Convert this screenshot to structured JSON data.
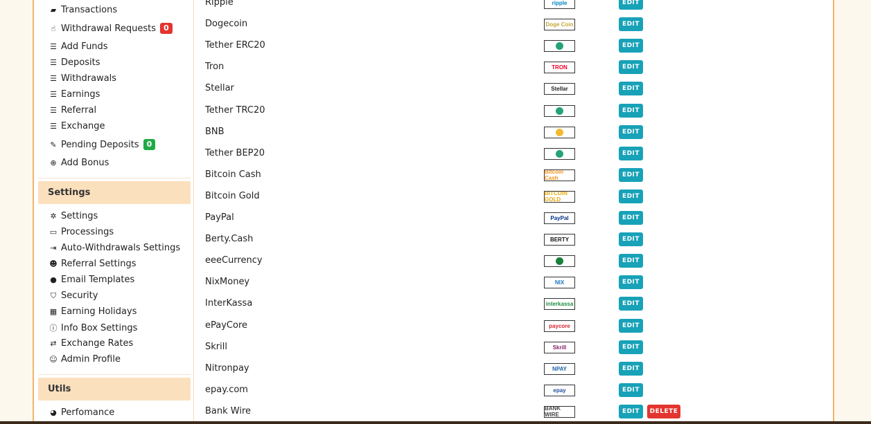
{
  "sidebar": {
    "items_top": [
      {
        "label": "Transactions",
        "icon": "book-icon",
        "badge": null
      },
      {
        "label": "Withdrawal Requests",
        "icon": "hand-icon",
        "badge": "0",
        "badge_color": "#e3342f"
      },
      {
        "label": "Add Funds",
        "icon": "list-icon",
        "badge": null
      },
      {
        "label": "Deposits",
        "icon": "list-icon",
        "badge": null
      },
      {
        "label": "Withdrawals",
        "icon": "list-icon",
        "badge": null
      },
      {
        "label": "Earnings",
        "icon": "list-icon",
        "badge": null
      },
      {
        "label": "Referral",
        "icon": "list-icon",
        "badge": null
      },
      {
        "label": "Exchange",
        "icon": "list-icon",
        "badge": null
      },
      {
        "label": "Pending Deposits",
        "icon": "pin-icon",
        "badge": "0",
        "badge_color": "#20a946"
      },
      {
        "label": "Add Bonus",
        "icon": "plus-circle-icon",
        "badge": null
      }
    ],
    "settings_heading": "Settings",
    "settings_items": [
      {
        "label": "Settings",
        "icon": "gear-icon"
      },
      {
        "label": "Processings",
        "icon": "card-icon"
      },
      {
        "label": "Auto-Withdrawals Settings",
        "icon": "sign-out-icon"
      },
      {
        "label": "Referral Settings",
        "icon": "users-icon"
      },
      {
        "label": "Email Templates",
        "icon": "comments-icon"
      },
      {
        "label": "Security",
        "icon": "shield-icon"
      },
      {
        "label": "Earning Holidays",
        "icon": "calendar-icon"
      },
      {
        "label": "Info Box Settings",
        "icon": "info-circle-icon"
      },
      {
        "label": "Exchange Rates",
        "icon": "exchange-icon"
      },
      {
        "label": "Admin Profile",
        "icon": "user-circle-icon"
      }
    ],
    "utils_heading": "Utils",
    "utils_items": [
      {
        "label": "Perfomance",
        "icon": "dashboard-icon"
      }
    ]
  },
  "processings": {
    "edit_label": "EDIT",
    "delete_label": "DELETE",
    "rows": [
      {
        "name": "Ripple",
        "logo_icon": "ripple-logo-icon",
        "logo_text": "ripple",
        "logo_color": "#0085c0",
        "deletable": false
      },
      {
        "name": "Dogecoin",
        "logo_icon": "dogecoin-logo-icon",
        "logo_text": "Doge Coin",
        "logo_color": "#c2a633",
        "deletable": false
      },
      {
        "name": "Tether ERC20",
        "logo_icon": "tether-erc20-logo-icon",
        "logo_text": "",
        "logo_color": "#26a17b",
        "deletable": false
      },
      {
        "name": "Tron",
        "logo_icon": "tron-logo-icon",
        "logo_text": "TRON",
        "logo_color": "#ef0027",
        "deletable": false
      },
      {
        "name": "Stellar",
        "logo_icon": "stellar-logo-icon",
        "logo_text": "Stellar",
        "logo_color": "#222222",
        "deletable": false
      },
      {
        "name": "Tether TRC20",
        "logo_icon": "tether-trc20-logo-icon",
        "logo_text": "",
        "logo_color": "#26a17b",
        "deletable": false
      },
      {
        "name": "BNB",
        "logo_icon": "bnb-logo-icon",
        "logo_text": "",
        "logo_color": "#f3ba2f",
        "deletable": false
      },
      {
        "name": "Tether BEP20",
        "logo_icon": "tether-bep20-logo-icon",
        "logo_text": "",
        "logo_color": "#26a17b",
        "deletable": false
      },
      {
        "name": "Bitcoin Cash",
        "logo_icon": "bitcoin-cash-logo-icon",
        "logo_text": "Bitcoin Cash",
        "logo_color": "#f7931a",
        "deletable": false
      },
      {
        "name": "Bitcoin Gold",
        "logo_icon": "bitcoin-gold-logo-icon",
        "logo_text": "BITCOIN GOLD",
        "logo_color": "#eba809",
        "deletable": false
      },
      {
        "name": "PayPal",
        "logo_icon": "paypal-logo-icon",
        "logo_text": "PayPal",
        "logo_color": "#003087",
        "deletable": false
      },
      {
        "name": "Berty.Cash",
        "logo_icon": "berty-logo-icon",
        "logo_text": "BERTY",
        "logo_color": "#111111",
        "deletable": false
      },
      {
        "name": "eeeCurrency",
        "logo_icon": "eeecurrency-logo-icon",
        "logo_text": "",
        "logo_color": "#1a7f3c",
        "deletable": false
      },
      {
        "name": "NixMoney",
        "logo_icon": "nixmoney-logo-icon",
        "logo_text": "NIX",
        "logo_color": "#1b75bb",
        "deletable": false
      },
      {
        "name": "InterKassa",
        "logo_icon": "interkassa-logo-icon",
        "logo_text": "interkassa",
        "logo_color": "#1c8e3e",
        "deletable": false
      },
      {
        "name": "ePayCore",
        "logo_icon": "epaycore-logo-icon",
        "logo_text": "paycore",
        "logo_color": "#d9232e",
        "deletable": false
      },
      {
        "name": "Skrill",
        "logo_icon": "skrill-logo-icon",
        "logo_text": "Skrill",
        "logo_color": "#862165",
        "deletable": false
      },
      {
        "name": "Nitronpay",
        "logo_icon": "nitronpay-logo-icon",
        "logo_text": "NPAY",
        "logo_color": "#1d5fa8",
        "deletable": false
      },
      {
        "name": "epay.com",
        "logo_icon": "epay-logo-icon",
        "logo_text": "epay",
        "logo_color": "#1d4f9a",
        "deletable": false
      },
      {
        "name": "Bank Wire",
        "logo_icon": "bank-wire-logo-icon",
        "logo_text": "BANK WIRE",
        "logo_color": "#444444",
        "deletable": true
      }
    ]
  }
}
